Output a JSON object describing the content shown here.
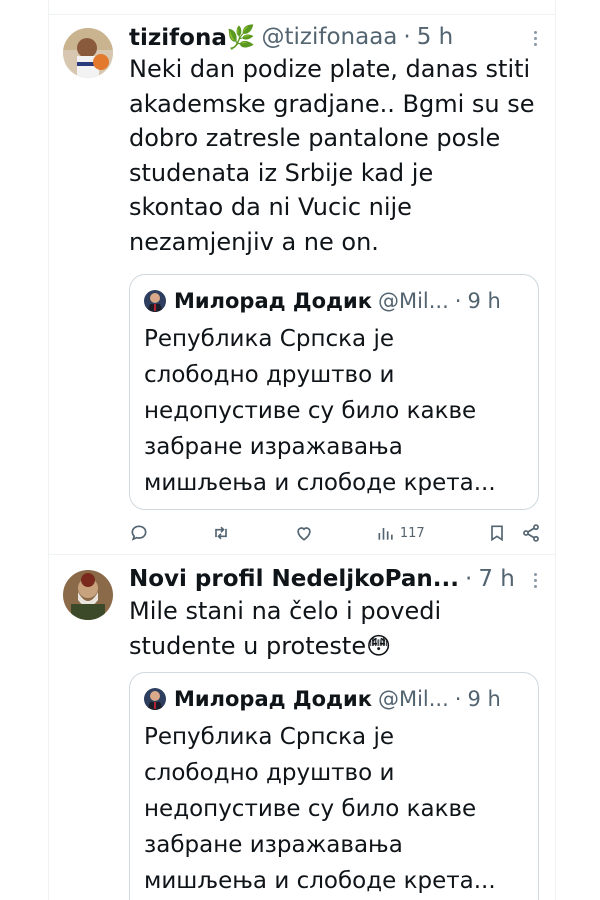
{
  "tweets": [
    {
      "name": "tizifona🌿",
      "handle": "@tizifonaaa",
      "separator": "·",
      "time": "5 h",
      "text": "Neki dan podize plate, danas stiti\nakademske gradjane.. Bgmi su se\ndobro zatresle pantalone posle\nstudenata iz Srbije kad je\nskontao da ni Vucic nije\nnezamjenjiv a ne on.",
      "quote": {
        "name": "Милорад Додик",
        "handle": "@Mil...",
        "separator": "·",
        "time": "9 h",
        "text": "Република Српска је\nслободно друштво и\nнедопустиве су било какве\nзабране изражавања\nмишљења и слободе крета..."
      },
      "actions": {
        "views": "117"
      }
    },
    {
      "name": "Novi profil NedeljkoPan...",
      "separator": "·",
      "time": "7 h",
      "text": "Mile stani na čelo i povedi\nstudente u proteste😳",
      "quote": {
        "name": "Милорад Додик",
        "handle": "@Mil...",
        "separator": "·",
        "time": "9 h",
        "text": "Република Српска је\nслободно друштво и\nнедопустиве су било какве\nзабране изражавања\nмишљења и слободе крета..."
      }
    }
  ],
  "icons": [
    "reply-icon",
    "retweet-icon",
    "like-icon",
    "views-icon",
    "bookmark-icon",
    "share-icon",
    "more-icon"
  ],
  "colors": {
    "text": "#0f1419",
    "secondary": "#536471",
    "border": "#cfd9de",
    "divider": "#eff3f4"
  }
}
